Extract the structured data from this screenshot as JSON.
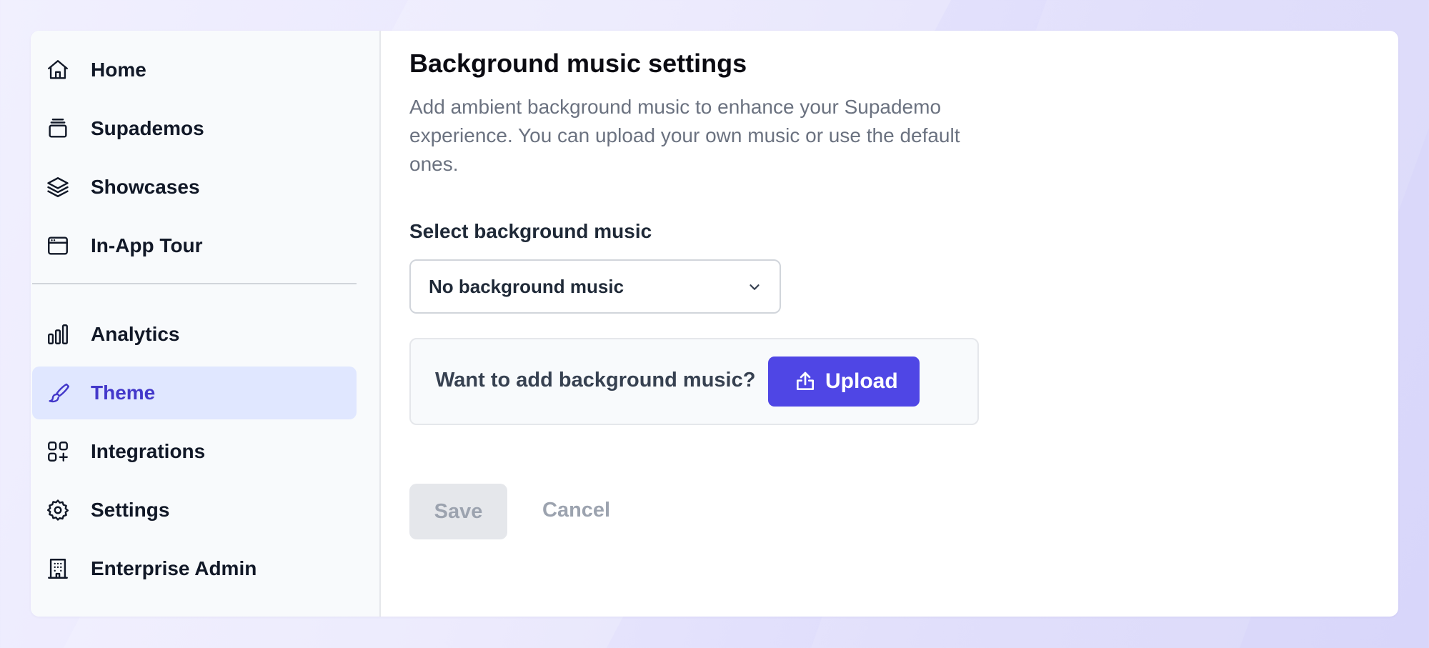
{
  "sidebar": {
    "items": [
      {
        "label": "Home",
        "icon": "home-icon"
      },
      {
        "label": "Supademos",
        "icon": "stack-icon"
      },
      {
        "label": "Showcases",
        "icon": "layers-icon"
      },
      {
        "label": "In-App Tour",
        "icon": "browser-window-icon"
      },
      {
        "label": "Analytics",
        "icon": "bar-chart-icon"
      },
      {
        "label": "Theme",
        "icon": "paintbrush-icon",
        "active": true
      },
      {
        "label": "Integrations",
        "icon": "apps-plus-icon"
      },
      {
        "label": "Settings",
        "icon": "gear-icon"
      },
      {
        "label": "Enterprise Admin",
        "icon": "building-icon"
      }
    ]
  },
  "main": {
    "title": "Background music settings",
    "description": "Add ambient background music to enhance your Supademo experience. You can upload your own music or use the default ones.",
    "select_label": "Select background music",
    "select": {
      "value": "No background music",
      "icon": "chevron-down-icon"
    },
    "upload_prompt": "Want to add background music?",
    "upload_button": {
      "label": "Upload",
      "icon": "upload-icon"
    },
    "save_label": "Save",
    "cancel_label": "Cancel"
  },
  "colors": {
    "accent": "#4F46E5",
    "active_bg": "#E0E7FF",
    "active_text": "#4338CA",
    "sidebar_bg": "#F8FAFC",
    "muted_text": "#6B7280",
    "disabled_bg": "#E5E7EB"
  }
}
